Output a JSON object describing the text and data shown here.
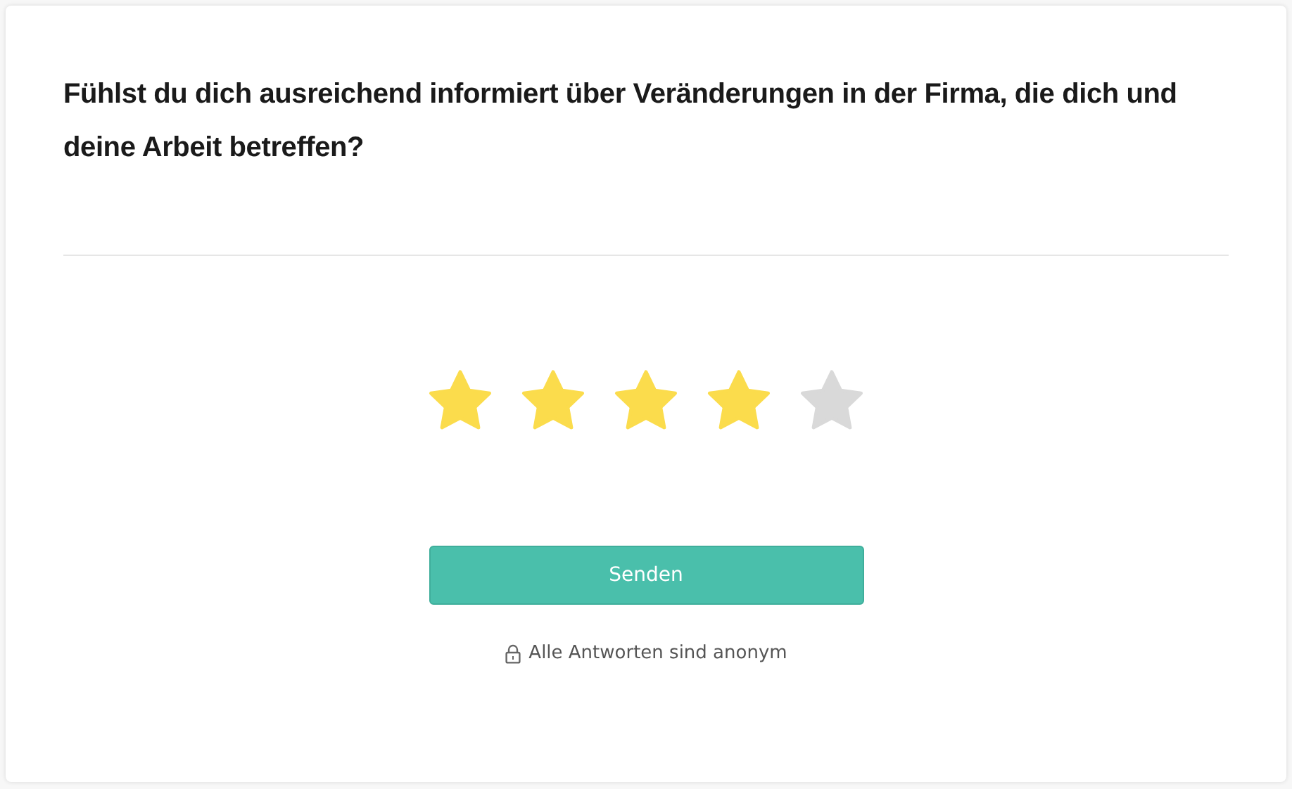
{
  "question": "Fühlst du dich ausreichend informiert über Veränderungen in der Firma, die dich und deine Arbeit betreffen?",
  "rating": {
    "stars": 4
  },
  "submit_button": "Senden",
  "anonymity_note": "Alle Antworten sind anonym"
}
